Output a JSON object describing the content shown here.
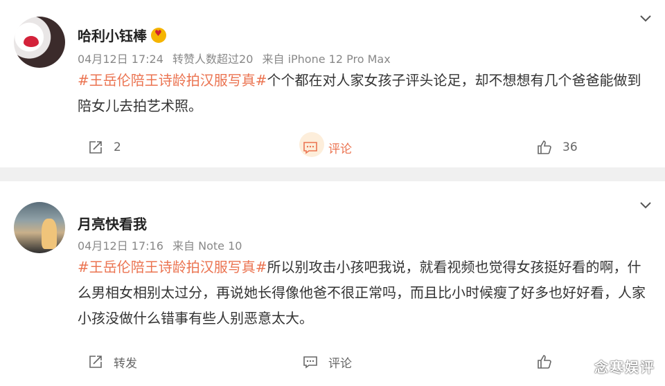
{
  "posts": [
    {
      "username": "哈利小钰棒",
      "date": "04月12日 17:24",
      "extra": "转赞人数超过20",
      "source": "来自 iPhone 12 Pro Max",
      "hashtag": "#王岳伦陪王诗龄拍汉服写真#",
      "text": "个个都在对人家女孩子评头论足，却不想想有几个爸爸能做到陪女儿去拍艺术照。",
      "share_label": "2",
      "comment_label": "评论",
      "like_label": "36"
    },
    {
      "username": "月亮快看我",
      "date": "04月12日 17:16",
      "source": "来自 Note 10",
      "hashtag": "#王岳伦陪王诗龄拍汉服写真#",
      "text": "所以别攻击小孩吧我说，就看视频也觉得女孩挺好看的啊，什么男相女相别太过分，再说她长得像他爸不很正常吗，而且比小时候瘦了好多也好好看，人家小孩没做什么错事有些人别恶意太大。",
      "share_label": "转发",
      "comment_label": "评论",
      "like_label": ""
    }
  ],
  "watermark": "念寒娱评",
  "colors": {
    "hashtag": "#eb7350",
    "comment_highlight": "#fdeedb",
    "badge": "#f5b400"
  },
  "icons": [
    "chevron-down-icon",
    "share-icon",
    "comment-icon",
    "like-icon",
    "vip-badge-icon"
  ]
}
